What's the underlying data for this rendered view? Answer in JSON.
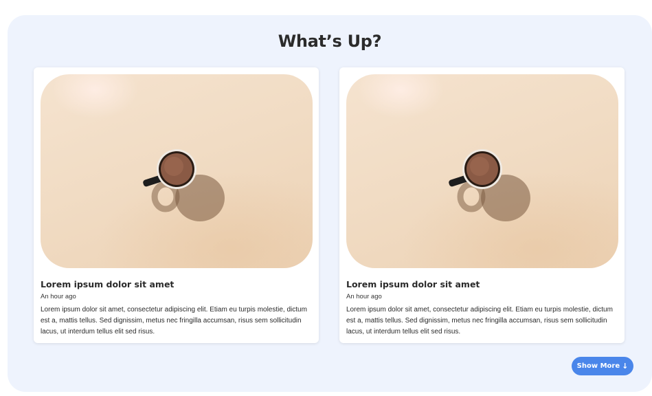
{
  "section": {
    "title": "What’s Up?"
  },
  "cards": [
    {
      "title": "Lorem ipsum dolor sit amet",
      "time": "An hour ago",
      "body": "Lorem ipsum dolor sit amet, consectetur adipiscing elit. Etiam eu turpis molestie, dictum est a, mattis tellus. Sed dignissim, metus nec fringilla accumsan, risus sem sollicitudin lacus, ut interdum tellus elit sed risus.",
      "image_icon": "coffee-cup-image"
    },
    {
      "title": "Lorem ipsum dolor sit amet",
      "time": "An hour ago",
      "body": "Lorem ipsum dolor sit amet, consectetur adipiscing elit. Etiam eu turpis molestie, dictum est a, mattis tellus. Sed dignissim, metus nec fringilla accumsan, risus sem sollicitudin lacus, ut interdum tellus elit sed risus.",
      "image_icon": "coffee-cup-image"
    }
  ],
  "show_more": {
    "label": "Show More",
    "icon": "arrow-down-icon",
    "glyph": "↓"
  },
  "colors": {
    "panel": "#eef3fd",
    "accent": "#4a86ea",
    "card": "#ffffff"
  }
}
